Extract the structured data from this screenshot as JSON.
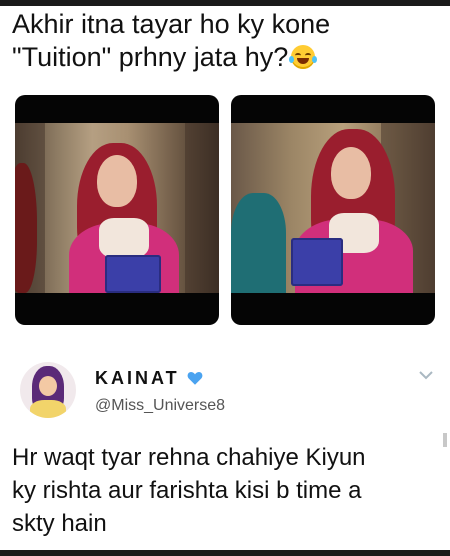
{
  "caption": {
    "line1": "Akhir itna tayar ho ky kone",
    "line2": "\"Tuition\" prhny jata hy?",
    "emoji": "face-with-tears-of-joy-icon"
  },
  "images": [
    {
      "name": "left-still"
    },
    {
      "name": "right-still"
    }
  ],
  "tweet": {
    "display_name": "KAINAT",
    "verified_icon": "blue-heart-icon",
    "handle": "@Miss_Universe8",
    "body_lines": [
      "Hr waqt tyar rehna chahiye Kiyun",
      "ky rishta aur farishta kisi b time a",
      "skty hain"
    ]
  },
  "colors": {
    "text": "#111111",
    "handle": "#555555",
    "heart": "#4aa3f0"
  }
}
